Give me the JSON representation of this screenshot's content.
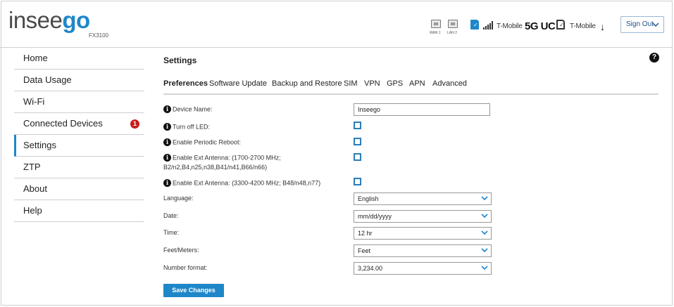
{
  "header": {
    "logo_part1": "insee",
    "logo_part2": "go",
    "model": "FX3100",
    "ports": [
      {
        "icon": "ethernet-port-icon",
        "label": "WAN 1"
      },
      {
        "icon": "ethernet-port-icon",
        "label": "LAN 2"
      }
    ],
    "carrier1": "T-Mobile",
    "network_type": "5G UC",
    "carrier2": "T-Mobile",
    "sign_out_label": "Sign Out",
    "accent_color": "#1e87c9"
  },
  "sidebar": {
    "items": [
      {
        "label": "Home"
      },
      {
        "label": "Data Usage"
      },
      {
        "label": "Wi-Fi"
      },
      {
        "label": "Connected Devices",
        "badge": "1"
      },
      {
        "label": "Settings",
        "active": true
      },
      {
        "label": "ZTP"
      },
      {
        "label": "About"
      },
      {
        "label": "Help"
      }
    ]
  },
  "main": {
    "title": "Settings",
    "help_label": "?",
    "tabs": [
      {
        "label": "Preferences",
        "active": true
      },
      {
        "label": "Software Update"
      },
      {
        "label": "Backup and Restore"
      },
      {
        "label": "SIM"
      },
      {
        "label": "VPN"
      },
      {
        "label": "GPS"
      },
      {
        "label": "APN"
      },
      {
        "label": "Advanced"
      }
    ],
    "form": {
      "device_name_label": "Device Name:",
      "device_name_value": "Inseego",
      "led_label": "Turn off LED:",
      "led_checked": false,
      "reboot_label": "Enable Periodic Reboot:",
      "reboot_checked": false,
      "ext_ant1_label_line1": "Enable Ext Antenna: (1700-2700 MHz;",
      "ext_ant1_label_line2": "B2/n2,B4,n25,n38,B41/n41,B66/n66)",
      "ext_ant1_checked": false,
      "ext_ant2_label": "Enable Ext Antenna: (3300-4200 MHz; B48/n48,n77)",
      "ext_ant2_checked": false,
      "language_label": "Language:",
      "language_value": "English",
      "date_label": "Date:",
      "date_value": "mm/dd/yyyy",
      "time_label": "Time:",
      "time_value": "12 hr",
      "units_label": "Feet/Meters:",
      "units_value": "Feet",
      "number_format_label": "Number format:",
      "number_format_value": "3,234.00"
    },
    "save_label": "Save Changes"
  }
}
